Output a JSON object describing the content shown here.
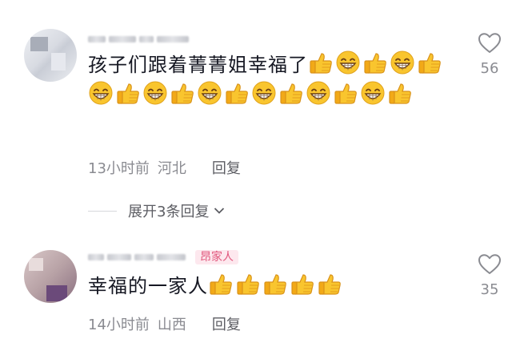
{
  "comments": [
    {
      "text": "孩子们跟着菁菁姐幸福了",
      "emojis": [
        "thumbs-up",
        "grin",
        "thumbs-up",
        "grin",
        "thumbs-up",
        "grin",
        "thumbs-up",
        "grin",
        "thumbs-up",
        "grin",
        "thumbs-up",
        "grin",
        "thumbs-up",
        "grin",
        "thumbs-up",
        "grin",
        "thumbs-up"
      ],
      "time": "13小时前",
      "location": "河北",
      "reply_label": "回复",
      "likes": "56",
      "expand_label": "展开3条回复"
    },
    {
      "tag": "昂家人",
      "text": "幸福的一家人",
      "emojis": [
        "thumbs-up",
        "thumbs-up",
        "thumbs-up",
        "thumbs-up",
        "thumbs-up"
      ],
      "time": "14小时前",
      "location": "山西",
      "reply_label": "回复",
      "likes": "35"
    }
  ],
  "colors": {
    "text": "#161823",
    "meta": "#8a8b91",
    "tag_text": "#e1567c",
    "tag_bg": "#fde8ee",
    "emoji_yellow": "#f9c52e"
  }
}
